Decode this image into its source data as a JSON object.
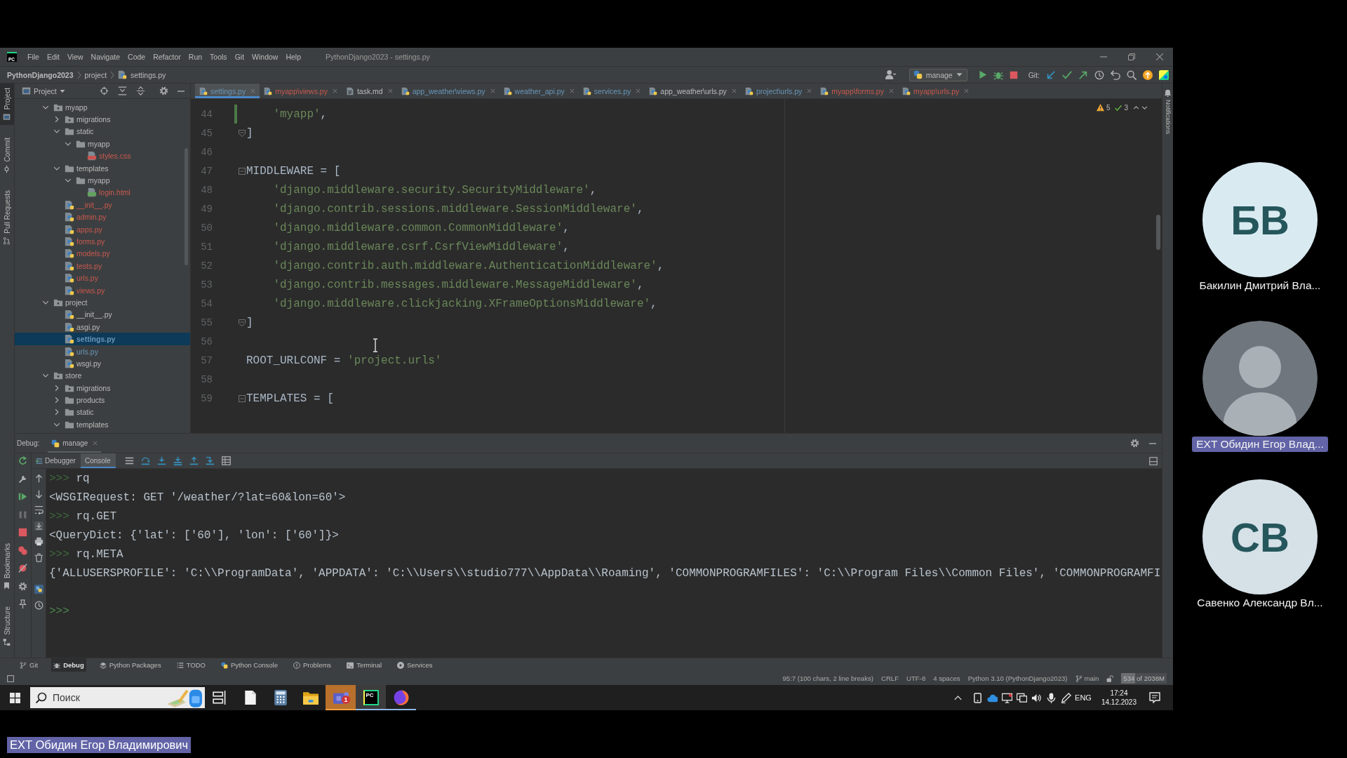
{
  "screen": {
    "ide": {
      "logo": "PC",
      "menu": [
        "File",
        "Edit",
        "View",
        "Navigate",
        "Code",
        "Refactor",
        "Run",
        "Tools",
        "Git",
        "Window",
        "Help"
      ],
      "window_title": "PythonDjango2023 - settings.py",
      "breadcrumbs": [
        "PythonDjango2023",
        "project",
        "settings.py"
      ],
      "run_config": "manage",
      "git_label": "Git:",
      "left_tool_windows": [
        {
          "label": "Project",
          "selected": true
        },
        {
          "label": "Commit",
          "selected": false
        },
        {
          "label": "Pull Requests",
          "selected": false
        }
      ],
      "left_bottom_tool_windows": [
        {
          "label": "Bookmarks",
          "selected": false
        },
        {
          "label": "Structure",
          "selected": false
        }
      ],
      "right_tool_windows": [
        {
          "label": "Notifications",
          "selected": false
        }
      ],
      "project_panel": {
        "title": "Project",
        "tree": [
          {
            "name": "myapp",
            "kind": "package",
            "expanded": true,
            "selected": false,
            "color": "#bbbbbb",
            "children": [
              {
                "name": "migrations",
                "kind": "package",
                "expanded": false,
                "selected": false,
                "color": "#bbbbbb"
              },
              {
                "name": "static",
                "kind": "folder",
                "expanded": true,
                "selected": false,
                "color": "#bbbbbb",
                "children": [
                  {
                    "name": "myapp",
                    "kind": "folder",
                    "expanded": true,
                    "selected": false,
                    "color": "#bbbbbb",
                    "children": [
                      {
                        "name": "styles.css",
                        "kind": "css",
                        "selected": false,
                        "color": "#c9594e"
                      }
                    ]
                  }
                ]
              },
              {
                "name": "templates",
                "kind": "folder",
                "expanded": true,
                "selected": false,
                "color": "#bbbbbb",
                "children": [
                  {
                    "name": "myapp",
                    "kind": "folder",
                    "expanded": true,
                    "selected": false,
                    "color": "#bbbbbb",
                    "children": [
                      {
                        "name": "login.html",
                        "kind": "html",
                        "selected": false,
                        "color": "#c9594e"
                      }
                    ]
                  }
                ]
              },
              {
                "name": "__init__.py",
                "kind": "python",
                "selected": false,
                "color": "#c9594e"
              },
              {
                "name": "admin.py",
                "kind": "python",
                "selected": false,
                "color": "#c9594e"
              },
              {
                "name": "apps.py",
                "kind": "python",
                "selected": false,
                "color": "#c9594e"
              },
              {
                "name": "forms.py",
                "kind": "python",
                "selected": false,
                "color": "#c9594e"
              },
              {
                "name": "models.py",
                "kind": "python",
                "selected": false,
                "color": "#c9594e"
              },
              {
                "name": "tests.py",
                "kind": "python",
                "selected": false,
                "color": "#c9594e"
              },
              {
                "name": "urls.py",
                "kind": "python",
                "selected": false,
                "color": "#c9594e"
              },
              {
                "name": "views.py",
                "kind": "python",
                "selected": false,
                "color": "#c9594e"
              }
            ]
          },
          {
            "name": "project",
            "kind": "package",
            "expanded": true,
            "selected": false,
            "color": "#bbbbbb",
            "children": [
              {
                "name": "__init__.py",
                "kind": "python",
                "selected": false,
                "color": "#bbbbbb"
              },
              {
                "name": "asgi.py",
                "kind": "python",
                "selected": false,
                "color": "#bbbbbb"
              },
              {
                "name": "settings.py",
                "kind": "python",
                "selected": true,
                "color": "#6897bb"
              },
              {
                "name": "urls.py",
                "kind": "python",
                "selected": false,
                "color": "#6897bb"
              },
              {
                "name": "wsgi.py",
                "kind": "python",
                "selected": false,
                "color": "#bbbbbb"
              }
            ]
          },
          {
            "name": "store",
            "kind": "package",
            "expanded": true,
            "selected": false,
            "color": "#bbbbbb",
            "children": [
              {
                "name": "migrations",
                "kind": "package",
                "expanded": false,
                "selected": false,
                "color": "#bbbbbb"
              },
              {
                "name": "products",
                "kind": "folder",
                "expanded": false,
                "selected": false,
                "color": "#bbbbbb"
              },
              {
                "name": "static",
                "kind": "folder",
                "expanded": false,
                "selected": false,
                "color": "#bbbbbb"
              },
              {
                "name": "templates",
                "kind": "folder",
                "expanded": true,
                "selected": false,
                "color": "#bbbbbb"
              }
            ]
          }
        ]
      },
      "editor": {
        "tabs": [
          {
            "label": "settings.py",
            "kind": "python",
            "selected": true,
            "color": "#6897bb"
          },
          {
            "label": "myapp\\views.py",
            "kind": "python",
            "selected": false,
            "color": "#c9594e"
          },
          {
            "label": "task.md",
            "kind": "markdown",
            "selected": false,
            "color": "#bbbbbb"
          },
          {
            "label": "app_weather\\views.py",
            "kind": "python",
            "selected": false,
            "color": "#6897bb"
          },
          {
            "label": "weather_api.py",
            "kind": "python",
            "selected": false,
            "color": "#6897bb"
          },
          {
            "label": "services.py",
            "kind": "python",
            "selected": false,
            "color": "#6897bb"
          },
          {
            "label": "app_weather\\urls.py",
            "kind": "python",
            "selected": false,
            "color": "#bbbbbb"
          },
          {
            "label": "project\\urls.py",
            "kind": "python",
            "selected": false,
            "color": "#6897bb"
          },
          {
            "label": "myapp\\forms.py",
            "kind": "python",
            "selected": false,
            "color": "#c9594e"
          },
          {
            "label": "myapp\\urls.py",
            "kind": "python",
            "selected": false,
            "color": "#c9594e"
          }
        ],
        "inspections": {
          "warnings": "5",
          "weak_warnings": "3"
        },
        "lines": [
          {
            "number": "44",
            "changed": true,
            "fold_start": false,
            "fold_end": false,
            "indented": true,
            "code": [
              {
                "kind": "string",
                "text": "'myapp'"
              },
              {
                "kind": "plain",
                "text": ","
              }
            ]
          },
          {
            "number": "45",
            "changed": false,
            "fold_start": false,
            "fold_end": true,
            "indented": false,
            "code": [
              {
                "kind": "plain",
                "text": "]"
              }
            ]
          },
          {
            "number": "46",
            "changed": false,
            "fold_start": false,
            "fold_end": false
          },
          {
            "number": "47",
            "changed": false,
            "fold_start": true,
            "fold_end": false,
            "indented": false,
            "code": [
              {
                "kind": "plain",
                "text": "MIDDLEWARE = ["
              }
            ]
          },
          {
            "number": "48",
            "changed": false,
            "fold_start": false,
            "fold_end": false,
            "indented": true,
            "code": [
              {
                "kind": "string",
                "text": "'django.middleware.security.SecurityMiddleware'"
              },
              {
                "kind": "plain",
                "text": ","
              }
            ]
          },
          {
            "number": "49",
            "changed": false,
            "fold_start": false,
            "fold_end": false,
            "indented": true,
            "code": [
              {
                "kind": "string",
                "text": "'django.contrib.sessions.middleware.SessionMiddleware'"
              },
              {
                "kind": "plain",
                "text": ","
              }
            ]
          },
          {
            "number": "50",
            "changed": false,
            "fold_start": false,
            "fold_end": false,
            "indented": true,
            "code": [
              {
                "kind": "string",
                "text": "'django.middleware.common.CommonMiddleware'"
              },
              {
                "kind": "plain",
                "text": ","
              }
            ]
          },
          {
            "number": "51",
            "changed": false,
            "fold_start": false,
            "fold_end": false,
            "indented": true,
            "code": [
              {
                "kind": "string",
                "text": "'django.middleware.csrf.CsrfViewMiddleware'"
              },
              {
                "kind": "plain",
                "text": ","
              }
            ]
          },
          {
            "number": "52",
            "changed": false,
            "fold_start": false,
            "fold_end": false,
            "indented": true,
            "code": [
              {
                "kind": "string",
                "text": "'django.contrib.auth.middleware.AuthenticationMiddleware'"
              },
              {
                "kind": "plain",
                "text": ","
              }
            ]
          },
          {
            "number": "53",
            "changed": false,
            "fold_start": false,
            "fold_end": false,
            "indented": true,
            "code": [
              {
                "kind": "string",
                "text": "'django.contrib.messages.middleware.MessageMiddleware'"
              },
              {
                "kind": "plain",
                "text": ","
              }
            ]
          },
          {
            "number": "54",
            "changed": false,
            "fold_start": false,
            "fold_end": false,
            "indented": true,
            "code": [
              {
                "kind": "string",
                "text": "'django.middleware.clickjacking.XFrameOptionsMiddleware'"
              },
              {
                "kind": "plain",
                "text": ","
              }
            ]
          },
          {
            "number": "55",
            "changed": false,
            "fold_start": false,
            "fold_end": true,
            "indented": false,
            "code": [
              {
                "kind": "plain",
                "text": "]"
              }
            ]
          },
          {
            "number": "56",
            "changed": false,
            "fold_start": false,
            "fold_end": false
          },
          {
            "number": "57",
            "changed": false,
            "fold_start": false,
            "fold_end": false,
            "indented": false,
            "code": [
              {
                "kind": "plain",
                "text": "ROOT_URLCONF = "
              },
              {
                "kind": "string",
                "text": "'project.urls'"
              }
            ]
          },
          {
            "number": "58",
            "changed": false,
            "fold_start": false,
            "fold_end": false
          },
          {
            "number": "59",
            "changed": false,
            "fold_start": true,
            "fold_end": false,
            "indented": false,
            "code": [
              {
                "kind": "plain",
                "text": "TEMPLATES = ["
              }
            ]
          }
        ]
      },
      "debug": {
        "title": "Debug:",
        "sessions": [
          {
            "label": "manage",
            "selected": true
          }
        ],
        "tabs": [
          {
            "label": "Debugger",
            "selected": false
          },
          {
            "label": "Console",
            "selected": true
          }
        ],
        "console": [
          {
            "kind": "input",
            "prompt": ">>>",
            "text": "rq"
          },
          {
            "kind": "output",
            "text": "<WSGIRequest: GET '/weather/?lat=60&lon=60'>"
          },
          {
            "kind": "input",
            "prompt": ">>>",
            "text": "rq.GET"
          },
          {
            "kind": "output",
            "text": "<QueryDict: {'lat': ['60'], 'lon': ['60']}>"
          },
          {
            "kind": "input",
            "prompt": ">>>",
            "text": "rq.META"
          },
          {
            "kind": "output",
            "text": "{'ALLUSERSPROFILE': 'C:\\\\ProgramData', 'APPDATA': 'C:\\\\Users\\\\studio777\\\\AppData\\\\Roaming', 'COMMONPROGRAMFILES': 'C:\\\\Program Files\\\\Common Files', 'COMMONPROGRAMFI"
          },
          {
            "kind": "prompt",
            "prompt": ">>>"
          }
        ]
      },
      "tool_window_bar": [
        {
          "label": "Git",
          "kind": "git",
          "selected": false
        },
        {
          "label": "Debug",
          "kind": "debug",
          "selected": true
        },
        {
          "label": "Python Packages",
          "kind": "packages",
          "selected": false
        },
        {
          "label": "TODO",
          "kind": "todo",
          "selected": false
        },
        {
          "label": "Python Console",
          "kind": "console",
          "selected": false
        },
        {
          "label": "Problems",
          "kind": "problems",
          "selected": false
        },
        {
          "label": "Terminal",
          "kind": "terminal",
          "selected": false
        },
        {
          "label": "Services",
          "kind": "services",
          "selected": false
        }
      ],
      "status_bar": {
        "selection": "95:7 (100 chars, 2 line breaks)",
        "line_separator": "CRLF",
        "encoding": "UTF-8",
        "indent": "4 spaces",
        "interpreter": "Python 3.10 (PythonDjango2023)",
        "branch": "main",
        "memory": {
          "text": "534 of 2038M",
          "level": 0.3
        }
      }
    },
    "taskbar": {
      "search_placeholder": "Поиск",
      "apps": [
        {
          "kind": "task-view",
          "active": false,
          "flashing": false,
          "running": false
        },
        {
          "kind": "notepad",
          "active": false,
          "flashing": false,
          "running": false
        },
        {
          "kind": "calculator",
          "active": false,
          "flashing": false,
          "running": false
        },
        {
          "kind": "file-explorer",
          "active": false,
          "flashing": false,
          "running": false
        },
        {
          "kind": "chat",
          "active": false,
          "flashing": true,
          "running": true,
          "badge": "1"
        },
        {
          "kind": "ide",
          "active": true,
          "flashing": false,
          "running": true,
          "label": "PC"
        },
        {
          "kind": "browser",
          "active": false,
          "flashing": false,
          "running": true
        }
      ],
      "language": "ENG",
      "time": "17:24",
      "date": "14.12.2023"
    },
    "participants": [
      {
        "name": "Бакилин Дмитрий Вла...",
        "kind": "initials",
        "initials": "БВ",
        "color": "#d9ebf1",
        "highlighted": false
      },
      {
        "name": "EXT Обидин Егор Влад...",
        "kind": "video",
        "highlighted": true
      },
      {
        "name": "Савенко Александр Вл...",
        "kind": "initials",
        "initials": "СВ",
        "color": "#d5e0e7",
        "highlighted": false
      }
    ],
    "presenter_label": "EXT Обидин Егор Владимирович"
  }
}
